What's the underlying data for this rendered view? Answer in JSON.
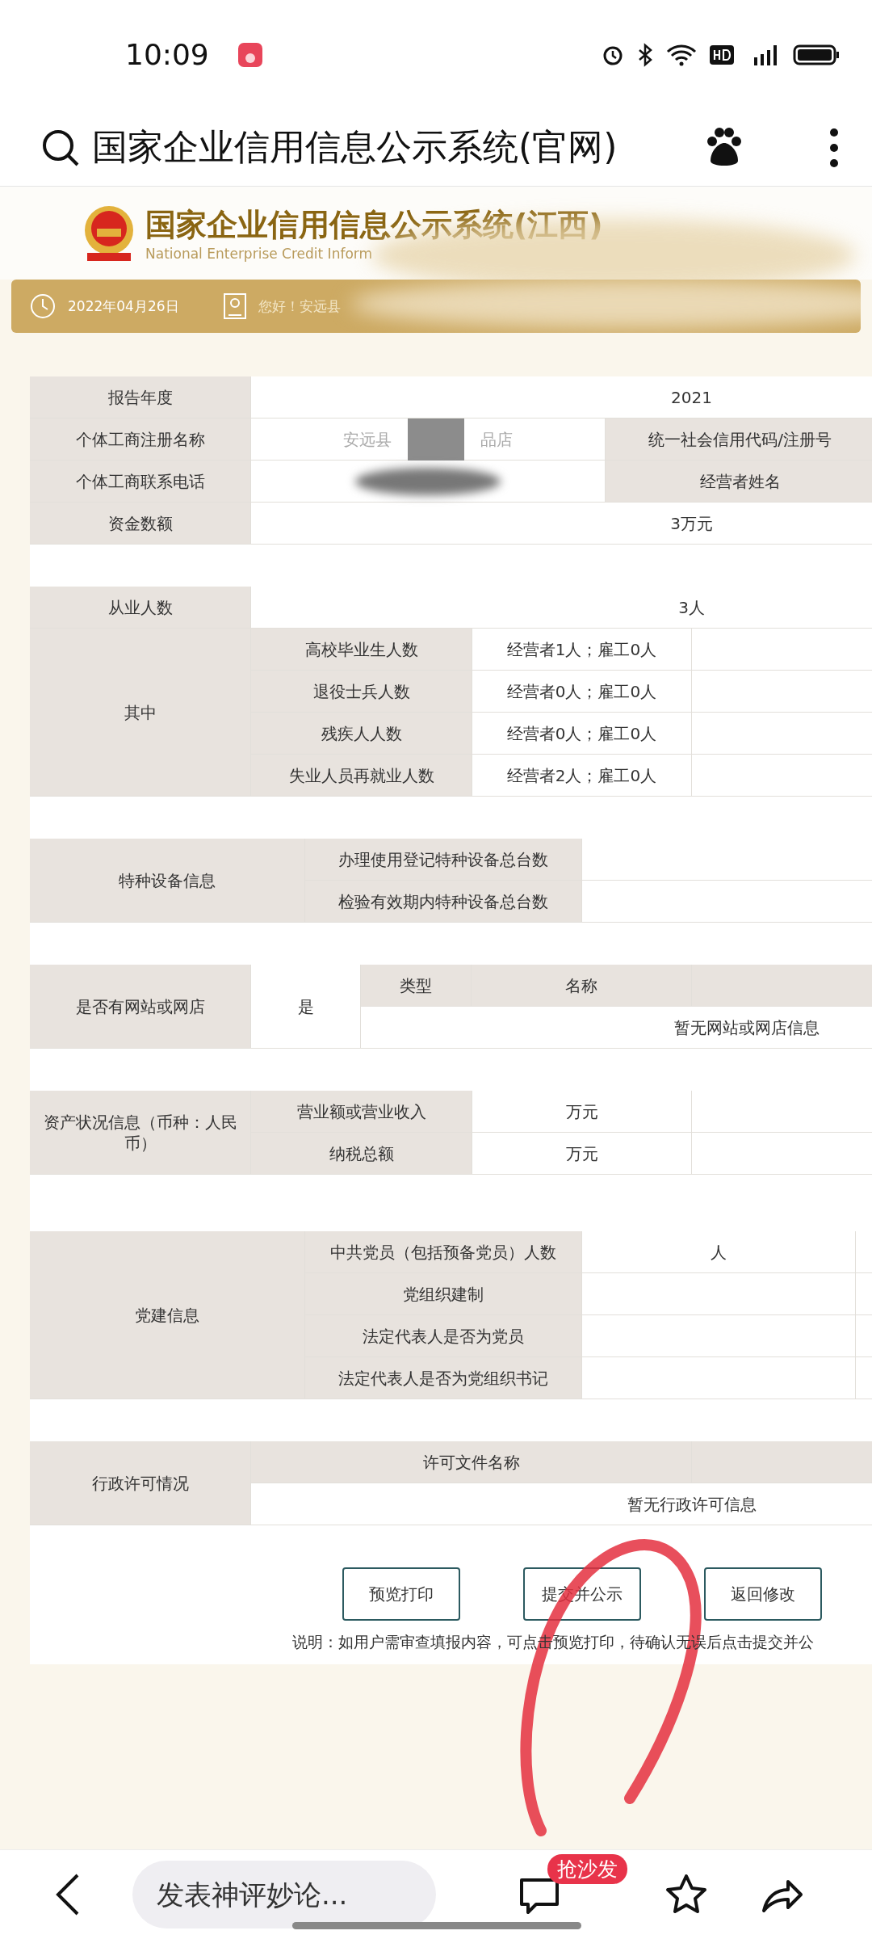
{
  "status_bar": {
    "time": "10:09"
  },
  "browser_bar": {
    "title": "国家企业信用信息公示系统(官网)"
  },
  "site_header": {
    "title": "国家企业信用信息公示系统(江西)",
    "subtitle": "National Enterprise Credit Inform",
    "date": "2022年04月26日",
    "greeting": "您好！安远县"
  },
  "basic_info": [
    {
      "kind": "wide",
      "label": "报告年度",
      "value": "2021"
    },
    {
      "kind": "split",
      "label": "个体工商注册名称",
      "value_parts": [
        "安远县",
        "品店"
      ],
      "label_2": "统一社会信用代码/注册号"
    },
    {
      "kind": "split",
      "label": "个体工商联系电话",
      "label_2": "经营者姓名"
    },
    {
      "kind": "wide",
      "label": "资金数额",
      "value": "3万元"
    }
  ],
  "employees": {
    "label": "从业人数",
    "value": "3人",
    "group_label": "其中",
    "rows": [
      {
        "label": "高校毕业生人数",
        "value": "经营者1人；雇工0人"
      },
      {
        "label": "退役士兵人数",
        "value": "经营者0人；雇工0人"
      },
      {
        "label": "残疾人人数",
        "value": "经营者0人；雇工0人"
      },
      {
        "label": "失业人员再就业人数",
        "value": "经营者2人；雇工0人"
      }
    ]
  },
  "special_equipment": {
    "label": "特种设备信息",
    "rows": [
      "办理使用登记特种设备总台数",
      "检验有效期内特种设备总台数"
    ]
  },
  "website": {
    "label": "是否有网站或网店",
    "value": "是",
    "columns": [
      "类型",
      "名称"
    ],
    "empty_text": "暂无网站或网店信息"
  },
  "assets": {
    "label": "资产状况信息（币种：人民币）",
    "rows": [
      {
        "label": "营业额或营业收入",
        "value": "万元"
      },
      {
        "label": "纳税总额",
        "value": "万元"
      }
    ]
  },
  "party": {
    "label": "党建信息",
    "rows": [
      {
        "label": "中共党员（包括预备党员）人数",
        "value": "人"
      },
      {
        "label": "党组织建制"
      },
      {
        "label": "法定代表人是否为党员"
      },
      {
        "label": "法定代表人是否为党组织书记"
      }
    ]
  },
  "permits": {
    "label": "行政许可情况",
    "columns": [
      "许可文件名称"
    ],
    "empty_text": "暂无行政许可信息"
  },
  "buttons": [
    "预览打印",
    "提交并公示",
    "返回修改"
  ],
  "note": "说明：如用户需审查填报内容，可点击预览打印，待确认无误后点击提交并公",
  "bottom_bar": {
    "placeholder": "发表神评妙论...",
    "badge": "抢沙发"
  }
}
